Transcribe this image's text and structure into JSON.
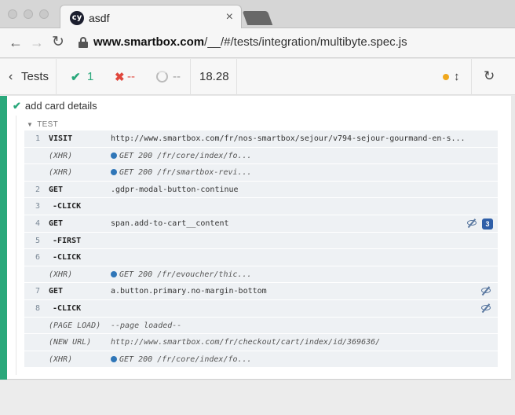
{
  "browser": {
    "tab_title": "asdf",
    "favicon_text": "cy",
    "close_glyph": "×",
    "url_host": "www.smartbox.com",
    "url_path": "/__/#/tests/integration/multibyte.spec.js",
    "back_glyph": "←",
    "forward_glyph": "→",
    "reload_glyph": "↻"
  },
  "header": {
    "tests_label": "Tests",
    "back_glyph": "‹",
    "passed_icon": "✔",
    "passed": "1",
    "failed_icon": "✖",
    "failed": "--",
    "pending": "--",
    "duration": "18.28",
    "scroll_glyph": "↕",
    "refresh_glyph": "↻",
    "status_color": "#f0a81d"
  },
  "test": {
    "check_glyph": "✔",
    "title": "add card details",
    "hook_caret": "▼",
    "hook": "TEST"
  },
  "commands": [
    {
      "num": "1",
      "name": "VISIT",
      "msg": "http://www.smartbox.com/fr/nos-smartbox/sejour/v794-sejour-gourmand-en-s..."
    },
    {
      "num": "",
      "name": "(XHR)",
      "event": true,
      "xhr": true,
      "msg": "GET 200 /fr/core/index/fo..."
    },
    {
      "num": "",
      "name": "(XHR)",
      "event": true,
      "xhr": true,
      "msg": "GET 200 /fr/smartbox-revi..."
    },
    {
      "num": "2",
      "name": "GET",
      "msg": ".gdpr-modal-button-continue"
    },
    {
      "num": "3",
      "name": "-CLICK",
      "child": true,
      "msg": ""
    },
    {
      "num": "4",
      "name": "GET",
      "msg": "span.add-to-cart__content",
      "eye": true,
      "badge": "3"
    },
    {
      "num": "5",
      "name": "-FIRST",
      "child": true,
      "msg": ""
    },
    {
      "num": "6",
      "name": "-CLICK",
      "child": true,
      "msg": ""
    },
    {
      "num": "",
      "name": "(XHR)",
      "event": true,
      "xhr": true,
      "msg": "GET 200 /fr/evoucher/thic..."
    },
    {
      "num": "7",
      "name": "GET",
      "msg": "a.button.primary.no-margin-bottom",
      "eye": true
    },
    {
      "num": "8",
      "name": "-CLICK",
      "child": true,
      "msg": "",
      "eye": true
    },
    {
      "num": "",
      "name": "(PAGE LOAD)",
      "event": true,
      "msg": "--page loaded--"
    },
    {
      "num": "",
      "name": "(NEW URL)",
      "event": true,
      "msg": "http://www.smartbox.com/fr/checkout/cart/index/id/369636/"
    },
    {
      "num": "",
      "name": "(XHR)",
      "event": true,
      "xhr": true,
      "msg": "GET 200 /fr/core/index/fo..."
    }
  ],
  "colors": {
    "pass": "#2aa87b",
    "fail": "#e0473d",
    "xhr": "#2f76b8",
    "badge": "#2f5fa8"
  }
}
